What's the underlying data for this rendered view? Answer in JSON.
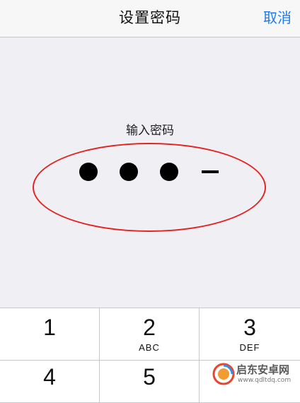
{
  "navbar": {
    "title": "设置密码",
    "cancel_label": "取消"
  },
  "passcode": {
    "prompt": "输入密码",
    "entered_digits": 3,
    "total_digits": 4
  },
  "annotation": {
    "color": "#e42323"
  },
  "keypad": {
    "keys": [
      {
        "number": "1",
        "letters": ""
      },
      {
        "number": "2",
        "letters": "ABC"
      },
      {
        "number": "3",
        "letters": "DEF"
      },
      {
        "number": "4",
        "letters": ""
      },
      {
        "number": "5",
        "letters": ""
      }
    ]
  },
  "watermark": {
    "text": "启东安卓网",
    "url": "www.qdltdq.com"
  },
  "colors": {
    "accent": "#1a7cf5",
    "background": "#efeff4"
  }
}
